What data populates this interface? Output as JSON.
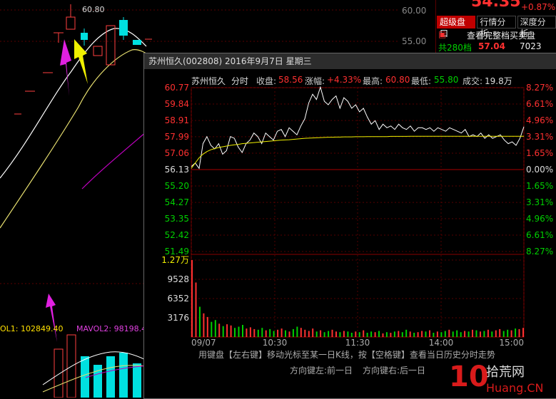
{
  "background_chart": {
    "price_top_label": "60.80",
    "axis_labels": [
      "60.00",
      "55.00"
    ],
    "vol_label_1": "OL1: 102849.40",
    "vol_label_2": "MAVOL2: 98198.4"
  },
  "quote_panel": {
    "price": "54.35",
    "change_pct": "+0.87%",
    "tabs": [
      "超级盘口",
      "行情分析",
      "深度分析"
    ],
    "full_orderbook_label": "查看完整档买卖盘",
    "levels_label": "共280档",
    "levels_price": "57.04",
    "levels_volume": "7023",
    "colors": {
      "up": "#ff3030",
      "down": "#00d000",
      "brand": "#c00000"
    }
  },
  "popup": {
    "title": "苏州恒久(002808) 2016年9月7日 星期三",
    "info": {
      "name": "苏州恒久",
      "mode": "分时",
      "close_label": "收盘:",
      "close_value": "58.56",
      "change_label": "涨幅:",
      "change_value": "+4.33%",
      "high_label": "最高:",
      "high_value": "60.80",
      "low_label": "最低:",
      "low_value": "55.80",
      "turnover_label": "成交:",
      "turnover_value": "19.8万"
    },
    "price_ticks_left": [
      "60.77",
      "59.84",
      "58.91",
      "57.99",
      "57.06",
      "56.13",
      "55.20",
      "54.27",
      "53.35",
      "52.42",
      "51.49"
    ],
    "pct_ticks_right": [
      "8.27%",
      "6.61%",
      "4.96%",
      "3.31%",
      "1.65%",
      "0.00%",
      "1.65%",
      "3.31%",
      "4.96%",
      "6.61%",
      "8.27%"
    ],
    "vol_ticks": [
      "1.27万",
      "9528",
      "6352",
      "3176"
    ],
    "time_ticks": [
      "09/07",
      "10:30",
      "11:30",
      "14:00",
      "15:00"
    ],
    "hint_line1": "用键盘【左右键】移动光标至某一日K线，按【空格键】查看当日历史分时走势",
    "hint_line2_left": "方向键左:前一日",
    "hint_line2_right": "方向键右:后一日"
  },
  "chart_data": {
    "type": "line",
    "title": "苏州恒久 分时",
    "x_ticks": [
      "09/07",
      "10:30",
      "11:30",
      "14:00",
      "15:00"
    ],
    "prev_close": 56.13,
    "ylim": [
      51.49,
      60.77
    ],
    "series": [
      {
        "values": [
          56.3,
          56.5,
          56.2,
          57.6,
          58.0,
          57.5,
          57.3,
          57.6,
          57.0,
          57.2,
          58.0,
          57.9,
          57.4,
          57.1,
          57.6,
          57.8,
          58.2,
          58.0,
          57.6,
          58.2,
          58.0,
          57.8,
          58.3,
          58.4,
          58.0,
          58.5,
          58.3,
          58.1,
          58.6,
          59.0,
          59.9,
          60.4,
          60.1,
          60.8,
          60.0,
          59.8,
          60.1,
          60.3,
          59.6,
          60.2,
          60.0,
          59.6,
          59.8,
          59.4,
          59.6,
          59.1,
          58.7,
          58.9,
          58.4,
          58.7,
          58.5,
          58.6,
          58.4,
          58.7,
          58.5,
          58.4,
          58.6,
          58.3,
          58.5,
          58.5,
          58.4,
          58.5,
          58.3,
          58.5,
          58.4,
          58.3,
          58.5,
          58.4,
          58.3,
          58.2,
          58.4,
          58.0,
          58.1,
          58.0,
          58.2,
          57.9,
          58.1,
          57.9,
          58.0,
          58.1,
          57.8,
          57.6,
          57.7,
          57.5,
          57.9,
          58.56
        ]
      },
      {
        "values": [
          56.2,
          56.5,
          56.8,
          57.0,
          57.15,
          57.25,
          57.32,
          57.38,
          57.42,
          57.46,
          57.5,
          57.53,
          57.56,
          57.6,
          57.62,
          57.64,
          57.66,
          57.68,
          57.7,
          57.72,
          57.74,
          57.76,
          57.78,
          57.8,
          57.81,
          57.82,
          57.84,
          57.86,
          57.88,
          57.9,
          57.91,
          57.92,
          57.93,
          57.94,
          57.95,
          57.96,
          57.96,
          57.97,
          57.97,
          57.98,
          57.98,
          57.98,
          57.99,
          57.99,
          57.99,
          58.0,
          58.0,
          58.0,
          58.0,
          58.0,
          58.0,
          58.01,
          58.01,
          58.01,
          58.01,
          58.01,
          58.02,
          58.02,
          58.02,
          58.02,
          58.02,
          58.02,
          58.02,
          58.02,
          58.02,
          58.02,
          58.02,
          58.02,
          58.02,
          58.02,
          58.02,
          58.02,
          58.02,
          58.02,
          58.02,
          58.02,
          58.02,
          58.02,
          58.02,
          58.02,
          58.02,
          58.02,
          58.02,
          58.02,
          58.02,
          58.02
        ]
      }
    ],
    "volume": {
      "ylim": [
        0,
        12700
      ],
      "values": [
        12700,
        9000,
        5000,
        3900,
        3300,
        2500,
        2800,
        2200,
        1800,
        2100,
        1900,
        1500,
        1700,
        2000,
        1400,
        1600,
        1300,
        1200,
        1500,
        1100,
        1300,
        1000,
        1200,
        1400,
        1100,
        900,
        1300,
        1700,
        1500,
        1200,
        1000,
        1400,
        900,
        1100,
        800,
        1000,
        1200,
        900,
        800,
        1000,
        900,
        700,
        900,
        800,
        1100,
        700,
        900,
        800,
        1000,
        600,
        800,
        700,
        900,
        1000,
        800,
        1200,
        900,
        700,
        800,
        1000,
        900,
        1100,
        700,
        900,
        800,
        1000,
        1200,
        900,
        1100,
        800,
        1000,
        900,
        1200,
        1100,
        900,
        1000,
        1200,
        900,
        1100,
        1300,
        1000,
        1200,
        1100,
        1400,
        1300,
        1500
      ]
    }
  }
}
